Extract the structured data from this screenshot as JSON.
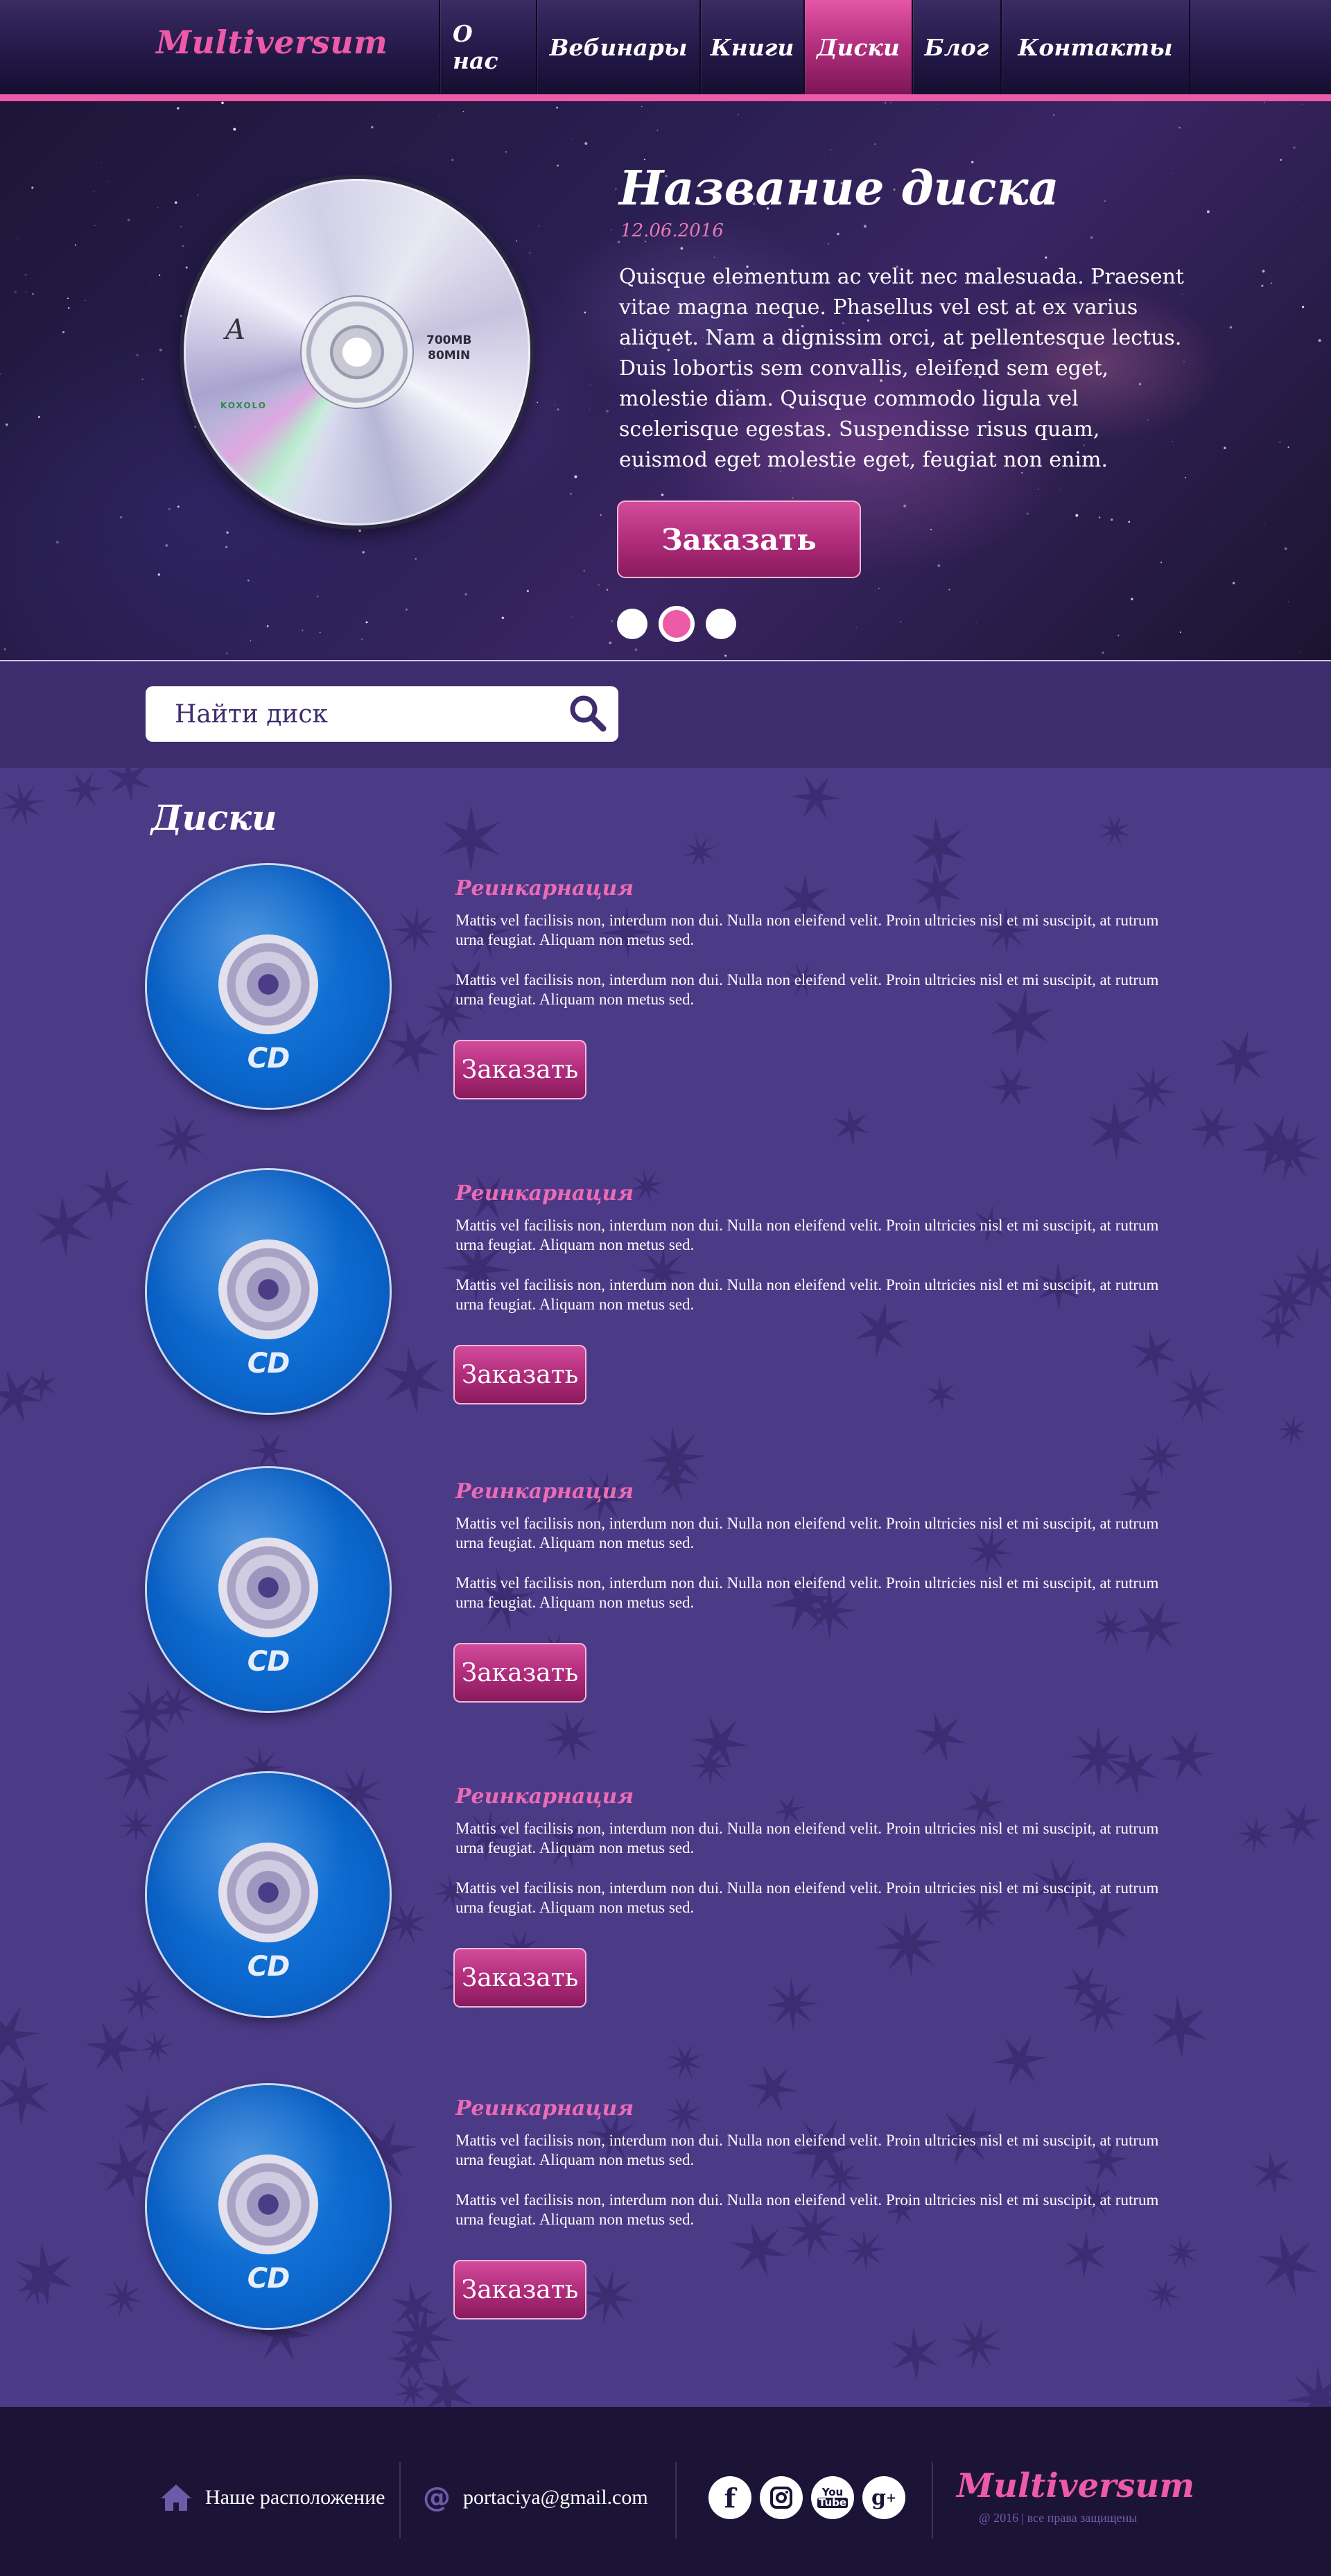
{
  "header": {
    "logo": "Multiversum",
    "nav": [
      {
        "label": "О нас",
        "active": false
      },
      {
        "label": "Вебинары",
        "active": false
      },
      {
        "label": "Книги",
        "active": false
      },
      {
        "label": "Диски",
        "active": true
      },
      {
        "label": "Блог",
        "active": false
      },
      {
        "label": "Контакты",
        "active": false
      }
    ]
  },
  "hero": {
    "title": "Название диска",
    "date": "12.06.2016",
    "text": "Quisque elementum ac velit nec malesuada. Praesent vitae magna neque. Phasellus vel est at ex varius aliquet. Nam a dignissim orci, at pellentesque lectus. Duis lobortis sem convallis, eleifend sem eget, molestie diam. Quisque commodo ligula vel scelerisque egestas. Suspendisse risus quam, euismod eget molestie eget, feugiat non enim.",
    "order_label": "Заказать",
    "disc_capacity_1": "700MB",
    "disc_capacity_2": "80MIN",
    "disc_brand": "KOXOLO",
    "slides": 3,
    "active_slide": 2
  },
  "search": {
    "placeholder": "Найти диск"
  },
  "discs": {
    "title": "Диски",
    "items": [
      {
        "title": "Реинкарнация",
        "p1": "Mattis vel facilisis non, interdum non dui. Nulla non eleifend velit. Proin ultricies nisl et mi suscipit, at rutrum urna feugiat. Aliquam non metus sed.",
        "p2": "Mattis vel facilisis non, interdum non dui. Nulla non eleifend velit. Proin ultricies nisl et mi suscipit, at rutrum urna feugiat. Aliquam non metus sed.",
        "order_label": "Заказать",
        "cd_label": "CD"
      },
      {
        "title": "Реинкарнация",
        "p1": "Mattis vel facilisis non, interdum non dui. Nulla non eleifend velit. Proin ultricies nisl et mi suscipit, at rutrum urna feugiat. Aliquam non metus sed.",
        "p2": "Mattis vel facilisis non, interdum non dui. Nulla non eleifend velit. Proin ultricies nisl et mi suscipit, at rutrum urna feugiat. Aliquam non metus sed.",
        "order_label": "Заказать",
        "cd_label": "CD"
      },
      {
        "title": "Реинкарнация",
        "p1": "Mattis vel facilisis non, interdum non dui. Nulla non eleifend velit. Proin ultricies nisl et mi suscipit, at rutrum urna feugiat. Aliquam non metus sed.",
        "p2": "Mattis vel facilisis non, interdum non dui. Nulla non eleifend velit. Proin ultricies nisl et mi suscipit, at rutrum urna feugiat. Aliquam non metus sed.",
        "order_label": "Заказать",
        "cd_label": "CD"
      },
      {
        "title": "Реинкарнация",
        "p1": "Mattis vel facilisis non, interdum non dui. Nulla non eleifend velit. Proin ultricies nisl et mi suscipit, at rutrum urna feugiat. Aliquam non metus sed.",
        "p2": "Mattis vel facilisis non, interdum non dui. Nulla non eleifend velit. Proin ultricies nisl et mi suscipit, at rutrum urna feugiat. Aliquam non metus sed.",
        "order_label": "Заказать",
        "cd_label": "CD"
      },
      {
        "title": "Реинкарнация",
        "p1": "Mattis vel facilisis non, interdum non dui. Nulla non eleifend velit. Proin ultricies nisl et mi suscipit, at rutrum urna feugiat. Aliquam non metus sed.",
        "p2": "Mattis vel facilisis non, interdum non dui. Nulla non eleifend velit. Proin ultricies nisl et mi suscipit, at rutrum urna feugiat. Aliquam non metus sed.",
        "order_label": "Заказать",
        "cd_label": "CD"
      }
    ]
  },
  "footer": {
    "location_label": "Наше расположение",
    "email": "portaciya@gmail.com",
    "social": [
      "facebook-icon",
      "instagram-icon",
      "youtube-icon",
      "google-plus-icon"
    ],
    "logo": "Multiversum",
    "copyright": "@ 2016 | все права защищены"
  },
  "colors": {
    "accent_pink": "#ec5aa8",
    "header_dark": "#221846",
    "page_purple": "#4b3a86",
    "search_strip": "#3d2c6e",
    "footer_dark": "#1c1437"
  }
}
